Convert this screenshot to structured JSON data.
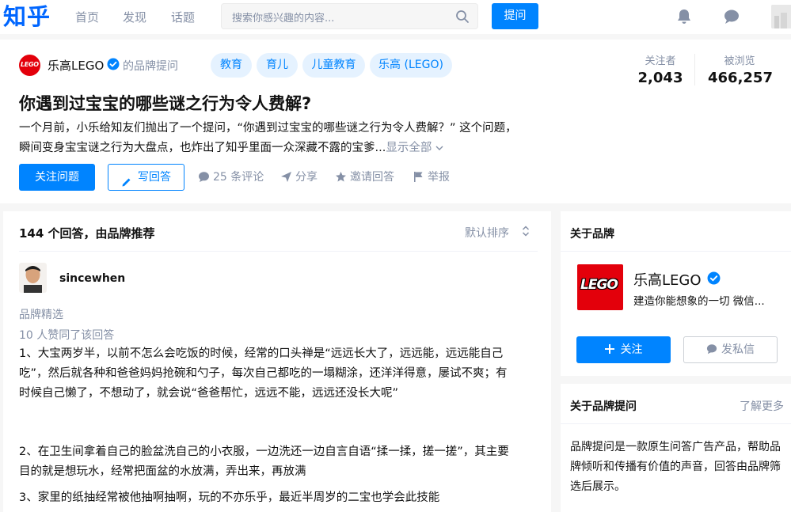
{
  "nav": {
    "logo": "知乎",
    "links": [
      "首页",
      "发现",
      "话题"
    ],
    "search_placeholder": "搜索你感兴趣的内容...",
    "ask_label": "提问",
    "icons": [
      "bell-icon",
      "chat-icon",
      "avatar"
    ]
  },
  "question": {
    "brand_name": "乐高LEGO",
    "brand_suffix": "的品牌提问",
    "tags": [
      "教育",
      "育儿",
      "儿童教育",
      "乐高 (LEGO)"
    ],
    "followers_label": "关注者",
    "followers_value": "2,043",
    "views_label": "被浏览",
    "views_value": "466,257",
    "title": "你遇到过宝宝的哪些谜之行为令人费解?",
    "desc_line1": "一个月前，小乐给知友们抛出了一个提问，“你遇到过宝宝的哪些谜之行为令人费解？” 这个问题，",
    "desc_line2": "瞬间变身宝宝谜之行为大盘点，也炸出了知乎里面一众深藏不露的宝爹...",
    "show_all": "显示全部",
    "follow_label": "关注问题",
    "write_label": "写回答",
    "comments_label": "25 条评论",
    "share_label": "分享",
    "invite_label": "邀请回答",
    "report_label": "举报"
  },
  "answers": {
    "count_label": "144 个回答，由品牌推荐",
    "sort_label": "默认排序",
    "username": "sincewhen",
    "badge": "品牌精选",
    "likes": "10 人赞同了该回答",
    "p1_l1": "1、大宝两岁半，以前不怎么会吃饭的时候，经常的口头禅是“远远长大了，远远能，远远能自己",
    "p1_l2": "吃”，然后就各种和爸爸妈妈抢碗和勺子，每次自己都吃的一塌糊涂，还洋洋得意，屡试不爽；有",
    "p1_l3": "时候自己懒了，不想动了，就会说“爸爸帮忙，远远不能，远远还没长大呢”",
    "p2_l1": "2、在卫生间拿着自己的脸盆洗自己的小衣服，一边洗还一边自言自语“揉一揉，搓一搓”，其主要",
    "p2_l2": "目的就是想玩水，经常把面盆的水放满，弄出来，再放满",
    "p3_l1": "3、家里的纸抽经常被他抽啊抽啊，玩的不亦乐乎，最近半周岁的二宝也学会此技能"
  },
  "sidebar": {
    "about_brand": "关于品牌",
    "brand_name": "乐高LEGO",
    "brand_slogan": "建造你能想象的一切 微信...",
    "logo_text": "LEGO",
    "follow_label": "关注",
    "message_label": "发私信",
    "about_q": "关于品牌提问",
    "learn_more": "了解更多",
    "desc": "品牌提问是一款原生问答广告产品，帮助品牌倾听和传播有价值的声音，回答由品牌筛选后展示。"
  },
  "colors": {
    "brand": "#0084ff",
    "lego_red": "#e3000b",
    "muted": "#8590a6"
  }
}
